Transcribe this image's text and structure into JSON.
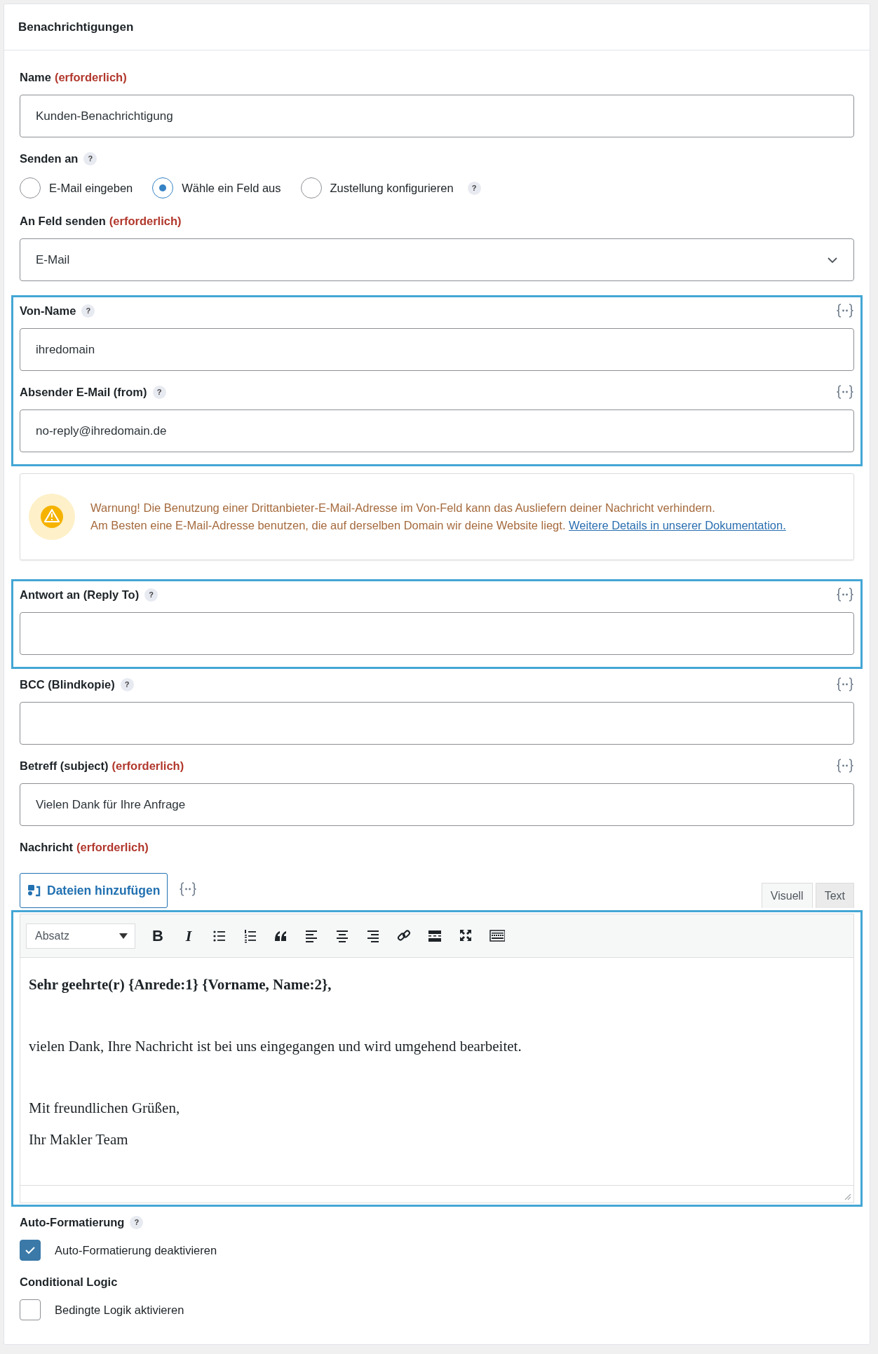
{
  "panel": {
    "title": "Benachrichtigungen"
  },
  "sections": [
    {
      "highlighted": false,
      "items": [
        {
          "kind": "text",
          "label": "Name",
          "required": "(erforderlich)",
          "value": "Kunden-Benachrichtigung"
        },
        {
          "kind": "radio",
          "label": "Senden an",
          "help": "?",
          "options": [
            {
              "label": "E-Mail eingeben",
              "selected": false
            },
            {
              "label": "Wähle ein Feld aus",
              "selected": true
            },
            {
              "label": "Zustellung konfigurieren",
              "selected": false,
              "help": "?"
            }
          ]
        },
        {
          "kind": "select",
          "label": "An Feld senden",
          "required": "(erforderlich)",
          "value": "E-Mail"
        }
      ]
    },
    {
      "highlighted": true,
      "items": [
        {
          "kind": "text",
          "label": "Von-Name",
          "help": "?",
          "merge_tags": true,
          "value": "ihredomain"
        },
        {
          "kind": "text",
          "label": "Absender E-Mail (from)",
          "help": "?",
          "merge_tags": true,
          "value": "no-reply@ihredomain.de"
        }
      ]
    },
    {
      "highlighted": false,
      "items": [
        {
          "kind": "warning",
          "lines": [
            "Warnung! Die Benutzung einer Drittanbieter-E-Mail-Adresse im Von-Feld kann das Ausliefern deiner Nachricht verhindern.",
            "Am Besten eine E-Mail-Adresse benutzen, die auf derselben Domain wir deine Website liegt."
          ],
          "link": "Weitere Details in unserer Dokumentation."
        }
      ]
    },
    {
      "highlighted": true,
      "items": [
        {
          "kind": "text",
          "label": "Antwort an (Reply To)",
          "help": "?",
          "merge_tags": true
        }
      ]
    },
    {
      "highlighted": false,
      "items": [
        {
          "kind": "text",
          "label": "BCC (Blindkopie)",
          "help": "?",
          "merge_tags": true
        },
        {
          "kind": "text",
          "label": "Betreff (subject)",
          "required": "(erforderlich)",
          "merge_tags": true,
          "value": "Vielen Dank für Ihre Anfrage"
        },
        {
          "kind": "editor_header",
          "label": "Nachricht",
          "required": "(erforderlich)",
          "button": "Dateien hinzufügen",
          "merge_tags": true,
          "tabs": [
            {
              "label": "Visuell",
              "selected": true
            },
            {
              "label": "Text",
              "selected": false
            }
          ]
        }
      ]
    },
    {
      "highlighted": true,
      "items": [
        {
          "kind": "editor",
          "format": "Absatz",
          "toolbar": [
            {
              "kind": "bold",
              "glyph": "B"
            },
            {
              "kind": "italic",
              "glyph": "I"
            },
            {
              "kind": "bullets"
            },
            {
              "kind": "numbers"
            },
            {
              "kind": "quote"
            },
            {
              "kind": "align-left"
            },
            {
              "kind": "align-center"
            },
            {
              "kind": "align-right"
            },
            {
              "kind": "link"
            },
            {
              "kind": "more"
            },
            {
              "kind": "fullscreen"
            },
            {
              "kind": "keyboard"
            }
          ],
          "blocks": [
            [
              {
                "text": "Sehr geehrte(r) {Anrede:1} {Vorname, Name:2},",
                "bold": true
              }
            ],
            [
              {
                "text": "vielen Dank, Ihre Nachricht ist bei uns eingegangen und wird umgehend bearbeitet.",
                "bold": false
              }
            ],
            [
              {
                "text": "Mit freundlichen Grüßen,",
                "bold": false
              },
              {
                "text": "Ihr Makler Team",
                "bold": false
              }
            ]
          ]
        }
      ]
    },
    {
      "highlighted": false,
      "items": [
        {
          "kind": "checkbox",
          "label": "Auto-Formatierung",
          "help": "?",
          "option": "Auto-Formatierung deaktivieren",
          "checked": true
        },
        {
          "kind": "checkbox",
          "label": "Conditional Logic",
          "option": "Bedingte Logik aktivieren",
          "checked": false
        }
      ]
    }
  ]
}
